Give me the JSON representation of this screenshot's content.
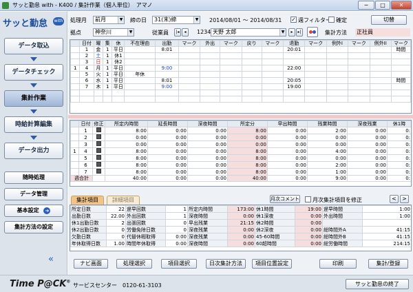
{
  "window": {
    "title": "サッと勤怠 with - K400 / 集計作業（個人単位）　アマノ",
    "min": "─",
    "max": "□",
    "close": "✕"
  },
  "logo": {
    "text": "サッと勤怠",
    "badge": "with"
  },
  "nav": [
    {
      "label": "データ取込"
    },
    {
      "label": "データチェック"
    },
    {
      "label": "集計作業"
    },
    {
      "label": "時給計算編集"
    },
    {
      "label": "データ出力"
    }
  ],
  "side_buttons": {
    "zuiji": "随時処理",
    "data_kanri": "データ管理",
    "kihon": "基本設定",
    "shukei_settei": "集計方法の設定",
    "collapse": "«"
  },
  "header": {
    "period_label": "処理月",
    "period_value": "前月",
    "close_label": "締の日",
    "close_value": "31(末)締",
    "range": "2014/08/01 ～ 2014/08/31",
    "week_filter_label": "週フィルター",
    "week_filter_checked": "✓",
    "kakutei_label": "確定",
    "switch_button": "切替",
    "site_label": "拠点",
    "site_value": "神奈川",
    "emp_label": "従業員",
    "emp_code": "1234",
    "emp_name": "天野 太郎",
    "nav_first": "|◂",
    "nav_prev": "◂",
    "nav_next": "▸",
    "nav_last": "▸|",
    "method_label": "集計方法",
    "method_value": "正社員"
  },
  "top_grid": {
    "columns": [
      "",
      "日付",
      "曜",
      "集",
      "休",
      "不在理由",
      "出勤",
      "マーク",
      "外出",
      "マーク",
      "戻り",
      "マーク",
      "退勤",
      "マーク",
      "例外I",
      "マーク",
      "例外II",
      "マーク"
    ],
    "rows": [
      [
        "",
        "1",
        "金",
        "1",
        "平日",
        "",
        "8:01",
        "",
        "",
        "",
        "",
        "",
        "20:01",
        "",
        "",
        "",
        "",
        "時間"
      ],
      [
        "",
        "2",
        "土",
        "1",
        "休1",
        "",
        "",
        "",
        "",
        "",
        "",
        "",
        "",
        "",
        "",
        "",
        "",
        ""
      ],
      [
        "",
        "3",
        "日",
        "1",
        "休2",
        "",
        "",
        "",
        "",
        "",
        "",
        "",
        "",
        "",
        "",
        "",
        "",
        ""
      ],
      [
        "1",
        "4",
        "月",
        "1",
        "平日",
        "",
        "9:00",
        "",
        "",
        "",
        "",
        "",
        "22:00",
        "",
        "",
        "",
        "",
        ""
      ],
      [
        "",
        "5",
        "火",
        "1",
        "平日",
        "年休",
        "",
        "",
        "",
        "",
        "",
        "",
        "",
        "",
        "",
        "",
        "",
        ""
      ],
      [
        "",
        "6",
        "水",
        "1",
        "平日",
        "",
        "8:01",
        "",
        "",
        "",
        "",
        "",
        "20:05",
        "",
        "",
        "",
        "",
        "時間"
      ],
      [
        "",
        "7",
        "木",
        "1",
        "平日",
        "",
        "9:00",
        "",
        "",
        "",
        "",
        "",
        "19:00",
        "",
        "",
        "",
        "",
        ""
      ]
    ]
  },
  "mid_grid": {
    "columns": [
      "",
      "日付",
      "修正",
      "所定内時間",
      "延長時間",
      "深夜時間",
      "所定分",
      "早出時間",
      "残業時間",
      "深夜残業",
      "休1時"
    ],
    "rows": [
      [
        "",
        "1",
        "",
        "8:00",
        "0:00",
        "0:00",
        "8:00",
        "0:00",
        "2:00",
        "0:00",
        "0:"
      ],
      [
        "",
        "2",
        "",
        "0:00",
        "0:00",
        "0:00",
        "0:00",
        "0:00",
        "0:00",
        "0:00",
        "0:"
      ],
      [
        "",
        "3",
        "",
        "0:00",
        "0:00",
        "0:00",
        "0:00",
        "0:00",
        "0:00",
        "0:00",
        "0:"
      ],
      [
        "1",
        "4",
        "",
        "8:00",
        "0:00",
        "0:00",
        "8:00",
        "0:00",
        "4:00",
        "0:00",
        "0:"
      ],
      [
        "",
        "5",
        "",
        "8:00",
        "0:00",
        "0:00",
        "8:00",
        "0:00",
        "0:00",
        "0:00",
        "0:"
      ],
      [
        "",
        "6",
        "",
        "8:00",
        "0:00",
        "0:00",
        "8:00",
        "0:00",
        "2:00",
        "0:00",
        "0:"
      ],
      [
        "",
        "7",
        "",
        "8:00",
        "0:00",
        "0:00",
        "8:00",
        "0:00",
        "1:00",
        "0:00",
        "0:"
      ]
    ],
    "total": [
      "週合計",
      "",
      "40:00",
      "0:00",
      "0:00",
      "40:00",
      "0:00",
      "9:00",
      "0:00",
      "0:"
    ]
  },
  "summary": {
    "tab1": "集計項目",
    "tab2": "詳細項目",
    "month_comment": "月次コメント",
    "fix_label": "月次集計項目を修正",
    "prev": "<",
    "next": ">",
    "rows": [
      [
        "所定日数",
        "22",
        "遅早回数",
        "1",
        "所定内時間",
        "173:00",
        "休1時間",
        "19:00",
        "遅早時間",
        "1:00"
      ],
      [
        "出勤日数",
        "22.00",
        "外出回数",
        "1",
        "深夜時間",
        "0:00",
        "休1深夜",
        "0:00",
        "外出時間",
        "1:00"
      ],
      [
        "休1出勤日数",
        "2",
        "出張回数",
        "0",
        "早出残業",
        "21:15",
        "休2時間",
        "0:00",
        "",
        ""
      ],
      [
        "休2出勤日数",
        "0",
        "労働免除日数",
        "0",
        "深夜残業",
        "0:00",
        "休2深夜",
        "0:00",
        "総時間外A",
        "41:15"
      ],
      [
        "欠勤日数",
        "0",
        "代替休暇取得",
        "0:00",
        "深夜残業",
        "0:00",
        "45-60時間",
        "0:00",
        "総時間外B",
        "41:15"
      ],
      [
        "年休取得日数",
        "1.00",
        "時間年休取得",
        "0:00",
        "深夜時間",
        "0:00",
        "60超時間",
        "0:00",
        "総労働時間",
        "214:15"
      ]
    ]
  },
  "actions": [
    "ナビ画面",
    "処理選択",
    "項目選択",
    "日次集計方法",
    "項目位置設定",
    "印刷",
    "集計/登録"
  ],
  "footer": {
    "brand": "Time P@CK",
    "tm": "®",
    "service": "サービスセンター　0120-61-3103",
    "exit": "サッと勤怠の終了"
  }
}
